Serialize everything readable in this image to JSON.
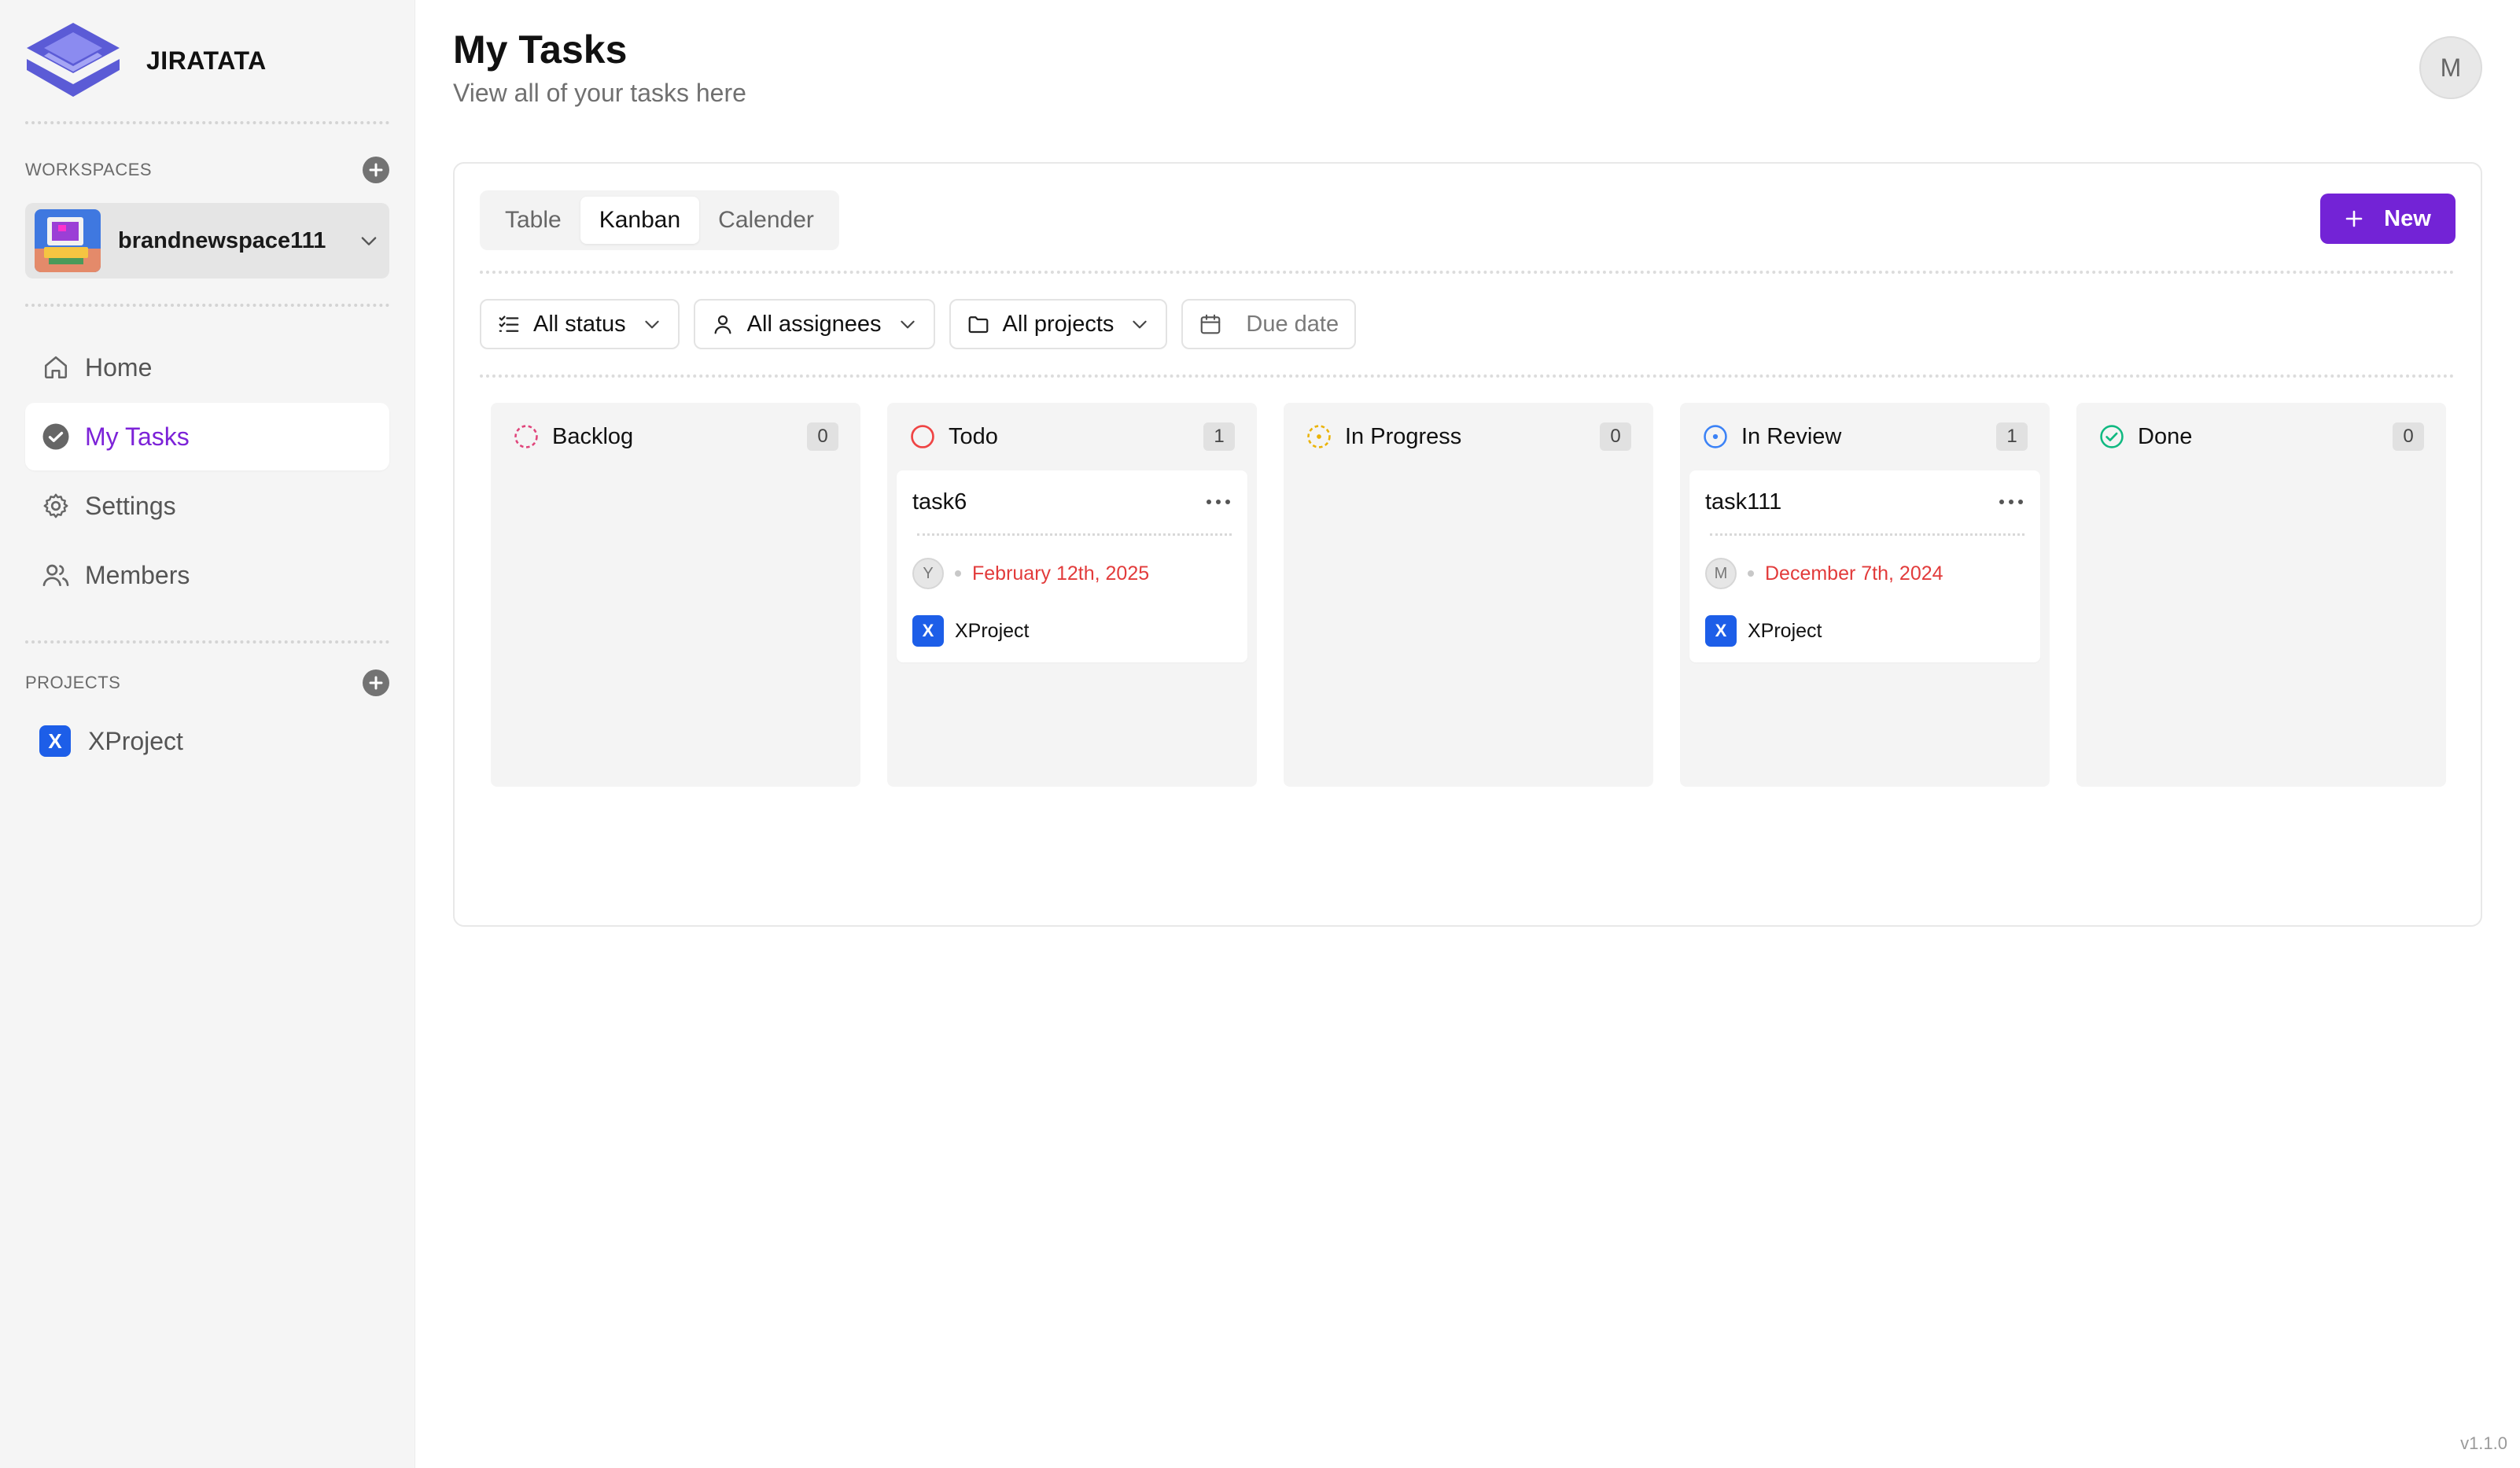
{
  "brand": {
    "name": "JIRATATA"
  },
  "sidebar": {
    "workspaces_title": "WORKSPACES",
    "workspace_name": "brandnewspace111",
    "nav": [
      {
        "label": "Home",
        "icon": "home-icon"
      },
      {
        "label": "My Tasks",
        "icon": "check-circle-icon",
        "active": true
      },
      {
        "label": "Settings",
        "icon": "gear-icon"
      },
      {
        "label": "Members",
        "icon": "users-icon"
      }
    ],
    "projects_title": "PROJECTS",
    "projects": [
      {
        "badge": "X",
        "name": "XProject"
      }
    ],
    "version": "v1.1.0"
  },
  "header": {
    "title": "My Tasks",
    "subtitle": "View all of your tasks here",
    "user_initial": "M"
  },
  "tabs": [
    {
      "label": "Table",
      "active": false
    },
    {
      "label": "Kanban",
      "active": true
    },
    {
      "label": "Calender",
      "active": false
    }
  ],
  "new_button": "New",
  "filters": {
    "status": "All status",
    "assignees": "All assignees",
    "projects": "All projects",
    "due_date": "Due date"
  },
  "columns": [
    {
      "title": "Backlog",
      "count": "0",
      "icon": "backlog-status-icon",
      "color": "#e0457b"
    },
    {
      "title": "Todo",
      "count": "1",
      "icon": "todo-status-icon",
      "color": "#ef4444",
      "card": {
        "title": "task6",
        "assignee": "Y",
        "due": "February 12th, 2025",
        "project_badge": "X",
        "project": "XProject"
      }
    },
    {
      "title": "In Progress",
      "count": "0",
      "icon": "in-progress-status-icon",
      "color": "#eab308"
    },
    {
      "title": "In Review",
      "count": "1",
      "icon": "in-review-status-icon",
      "color": "#3b82f6",
      "card": {
        "title": "task111",
        "assignee": "M",
        "due": "December 7th, 2024",
        "project_badge": "X",
        "project": "XProject"
      }
    },
    {
      "title": "Done",
      "count": "0",
      "icon": "done-status-icon",
      "color": "#10b981"
    }
  ],
  "colors": {
    "accent": "#7323d6",
    "project_badge": "#1d5ee8",
    "due_date": "#e23b3b"
  }
}
